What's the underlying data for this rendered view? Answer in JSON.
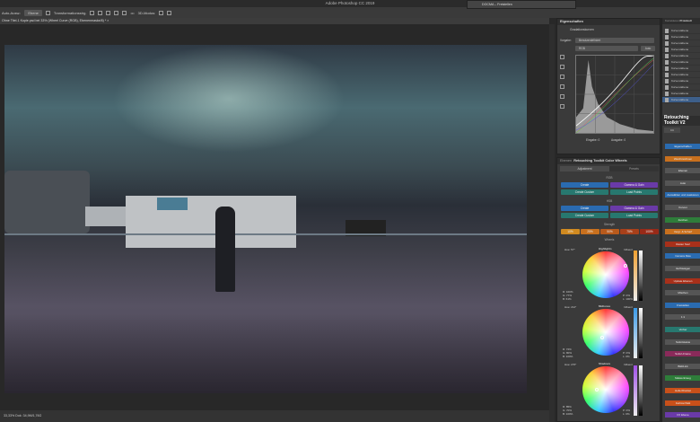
{
  "app": {
    "title": "Adobe Photoshop CC 2019"
  },
  "options": {
    "auto_label": "Auto-Ausw.:",
    "auto_value": "Ebene",
    "transform_label": "Transformationsstrg.",
    "mode_3d": "3D-Modus:"
  },
  "document": {
    "tab": "Ohne Titel-1 Kopie.psd bei 33% (Wheel Curve (RGB), Ebenenmaske/8) *",
    "status": "33,33%   Dok: 34,9M/1,76G"
  },
  "docma": {
    "title": "DOCMA – Freistellen"
  },
  "properties": {
    "title": "Eigenschaften",
    "subtitle": "Gradationskurven",
    "preset_label": "Vorgabe:",
    "preset_value": "Benutzerdefiniert",
    "channel": "RGB",
    "auto_button": "Auto",
    "input_label": "Eingabe:",
    "input_value": "0",
    "output_label": "Ausgabe:",
    "output_value": "0"
  },
  "retouch": {
    "tab_other": "Ebenen",
    "title": "Retouching Toolkit Color Wheels",
    "tabs": [
      "Adjustment",
      "Presets"
    ],
    "rgb_label": "RGB",
    "hsb_label": "HSB",
    "buttons": {
      "create": "Create",
      "gamma": "Gamma & Gain",
      "create_custom": "Create Custom",
      "load_points": "Load Points"
    },
    "strength_label": "Strength",
    "strengths": [
      "10%",
      "25%",
      "50%",
      "75%",
      "100%"
    ],
    "wheels_label": "Wheels",
    "wheels": [
      {
        "name": "Highlights",
        "hue": "Hue: 57°",
        "side": "Influent",
        "r": "R: 100%",
        "g": "G: 77%",
        "b": "B: 61%",
        "pr": "P: 0%",
        "l": "L: 100%",
        "accent": "#f0a030"
      },
      {
        "name": "Midtones",
        "hue": "Hue: 212°",
        "side": "Influent",
        "r": "R: 72%",
        "g": "G: 80%",
        "b": "B: 100%",
        "pr": "P: 0%",
        "l": "L: 0%",
        "accent": "#3a9ae8"
      },
      {
        "name": "Shadows",
        "hue": "Hue: 270°",
        "side": "Influent",
        "r": "R: 85%",
        "g": "G: 70%",
        "b": "B: 100%",
        "pr": "P: 0%",
        "l": "L: 0%",
        "accent": "#a050e8"
      }
    ]
  },
  "layers": {
    "tabs": [
      "Korrekturen",
      "Protokoll"
    ],
    "items": [
      "Kurven-Ebene",
      "Kurven-Ebene",
      "Kurven-Ebene",
      "Kurven-Ebene",
      "Kurven-Ebene",
      "Kurven-Ebene",
      "Kurven-Ebene",
      "Kurven-Ebene",
      "Kurven-Ebene",
      "Kurven-Ebene",
      "Kurven-Ebene",
      "Kurven-Ebene"
    ]
  },
  "toolkit": {
    "title": "Retouching Toolkit V2",
    "tab": "CC",
    "buttons": [
      "Eigenschaften",
      "Weichzeichnen",
      "Ebenen",
      "Auto",
      "Auswählen und maskieren",
      "Kurven",
      "Zeichen",
      "Vergr. & Scharf",
      "Raster Sw2",
      "Camera Raw",
      "Verflüssigen",
      "Update Ebenen",
      "Mischen",
      "Freistellen",
      "1:1",
      "Vorher",
      "Sofortstatus",
      "Sofort-Frame",
      "Bild/Link",
      "Malwerkzeug",
      "Heller/Dunkel",
      "Farbton/Sätt",
      "FX Ebene"
    ]
  }
}
